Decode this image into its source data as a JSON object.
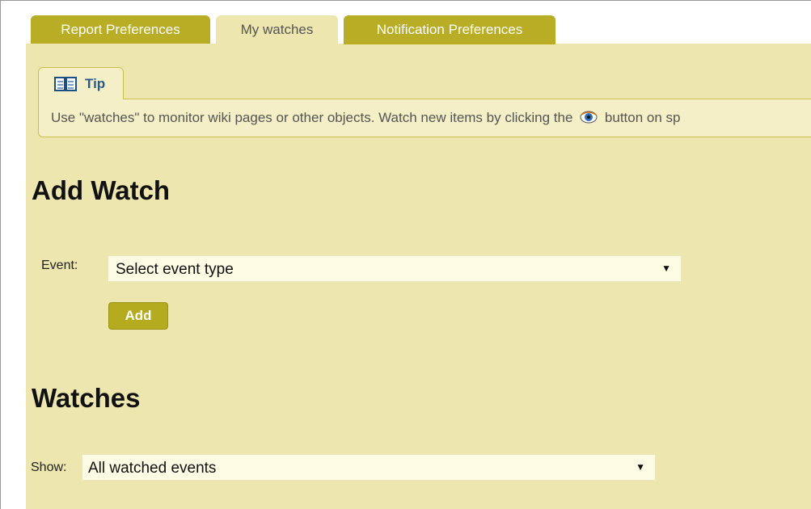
{
  "tabs": [
    {
      "label": "Report Preferences",
      "active": false
    },
    {
      "label": "My watches",
      "active": true
    },
    {
      "label": "Notification Preferences",
      "active": false
    }
  ],
  "tip": {
    "icon": "book-icon",
    "title": "Tip",
    "text_before": "Use \"watches\" to monitor wiki pages or other objects. Watch new items by clicking the",
    "inline_icon": "eye-icon",
    "text_after": "button on sp"
  },
  "add_watch": {
    "heading": "Add Watch",
    "event_label": "Event:",
    "event_select_value": "Select event type",
    "add_button_label": "Add"
  },
  "watches": {
    "heading": "Watches",
    "show_label": "Show:",
    "show_select_value": "All watched events"
  },
  "colors": {
    "tab_inactive": "#b8ad24",
    "panel_background": "#ede6ae",
    "tip_background": "#f4efc6",
    "button": "#b5ab1e"
  }
}
